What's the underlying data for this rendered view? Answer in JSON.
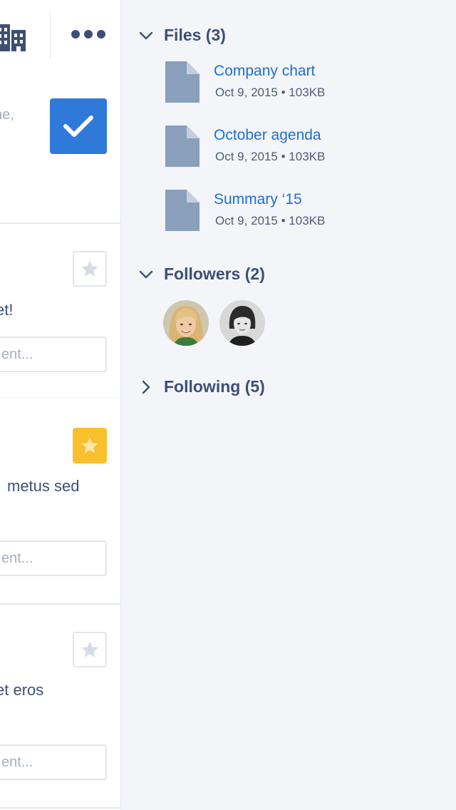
{
  "feed": {
    "composer_text": "ne,",
    "posts": [
      {
        "text": "et!",
        "comment_placeholder": "ent...",
        "starred": false
      },
      {
        "text": "metus sed",
        "comment_placeholder": "ent...",
        "starred": true
      },
      {
        "text": "et eros",
        "comment_placeholder": "ent...",
        "starred": false
      }
    ]
  },
  "sidebar": {
    "files": {
      "title": "Files (3)",
      "expanded": true,
      "items": [
        {
          "name": "Company chart",
          "meta": "Oct 9, 2015 • 103KB"
        },
        {
          "name": "October agenda",
          "meta": "Oct 9, 2015 • 103KB"
        },
        {
          "name": "Summary ‘15",
          "meta": "Oct 9, 2015 • 103KB"
        }
      ]
    },
    "followers": {
      "title": "Followers (2)",
      "expanded": true,
      "avatars": [
        "avatar-woman-blonde",
        "avatar-person-dark-hair"
      ]
    },
    "following": {
      "title": "Following (5)",
      "expanded": false
    }
  },
  "colors": {
    "accent_blue": "#2f7ad8",
    "link_blue": "#1f6fd0",
    "star_yellow": "#f9c02e",
    "text_navy": "#3d4f74",
    "panel_bg": "#f3f5f9"
  }
}
